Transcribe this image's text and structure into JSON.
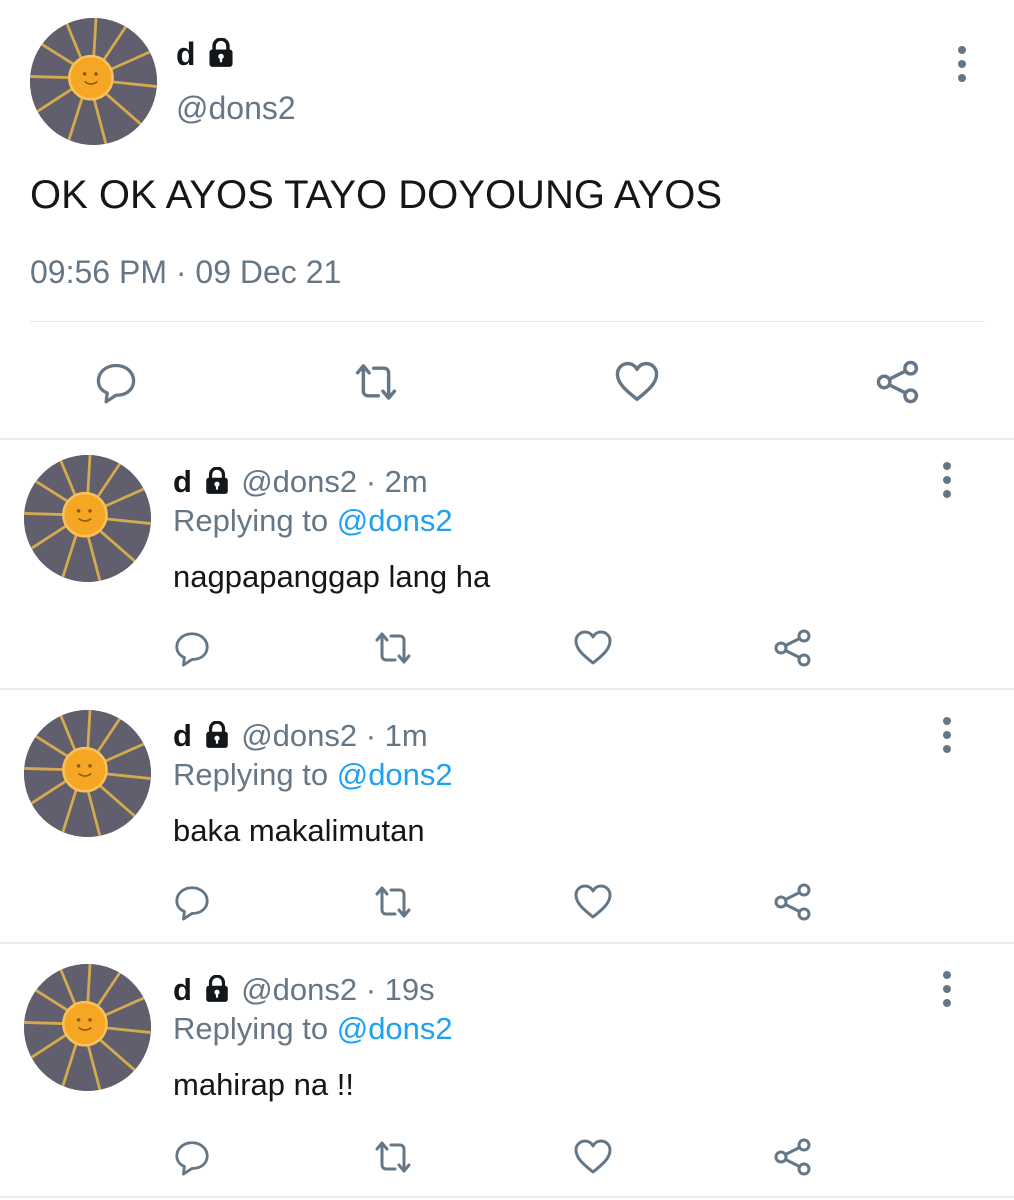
{
  "main_tweet": {
    "display_name": "d",
    "handle": "@dons2",
    "text": "OK OK AYOS TAYO DOYOUNG AYOS",
    "time": "09:56 PM",
    "separator": "·",
    "date": "09 Dec 21",
    "avatar_icon": "sun-avatar",
    "lock_icon": "lock-icon"
  },
  "replies": [
    {
      "display_name": "d",
      "handle_time": "@dons2 · 2m",
      "replying_prefix": "Replying to ",
      "replying_handle": "@dons2",
      "text": "nagpapanggap lang ha"
    },
    {
      "display_name": "d",
      "handle_time": "@dons2 · 1m",
      "replying_prefix": "Replying to ",
      "replying_handle": "@dons2",
      "text": "baka makalimutan"
    },
    {
      "display_name": "d",
      "handle_time": "@dons2 · 19s",
      "replying_prefix": "Replying to ",
      "replying_handle": "@dons2",
      "text": "mahirap na !!"
    }
  ],
  "actions": [
    "reply-icon",
    "retweet-icon",
    "like-icon",
    "share-icon"
  ],
  "colors": {
    "text": "#14171a",
    "muted": "#657786",
    "link": "#1da1f2",
    "divider": "#e6ecf0",
    "avatar_bg": "#5e5b6b",
    "sun": "#f4a51c"
  }
}
